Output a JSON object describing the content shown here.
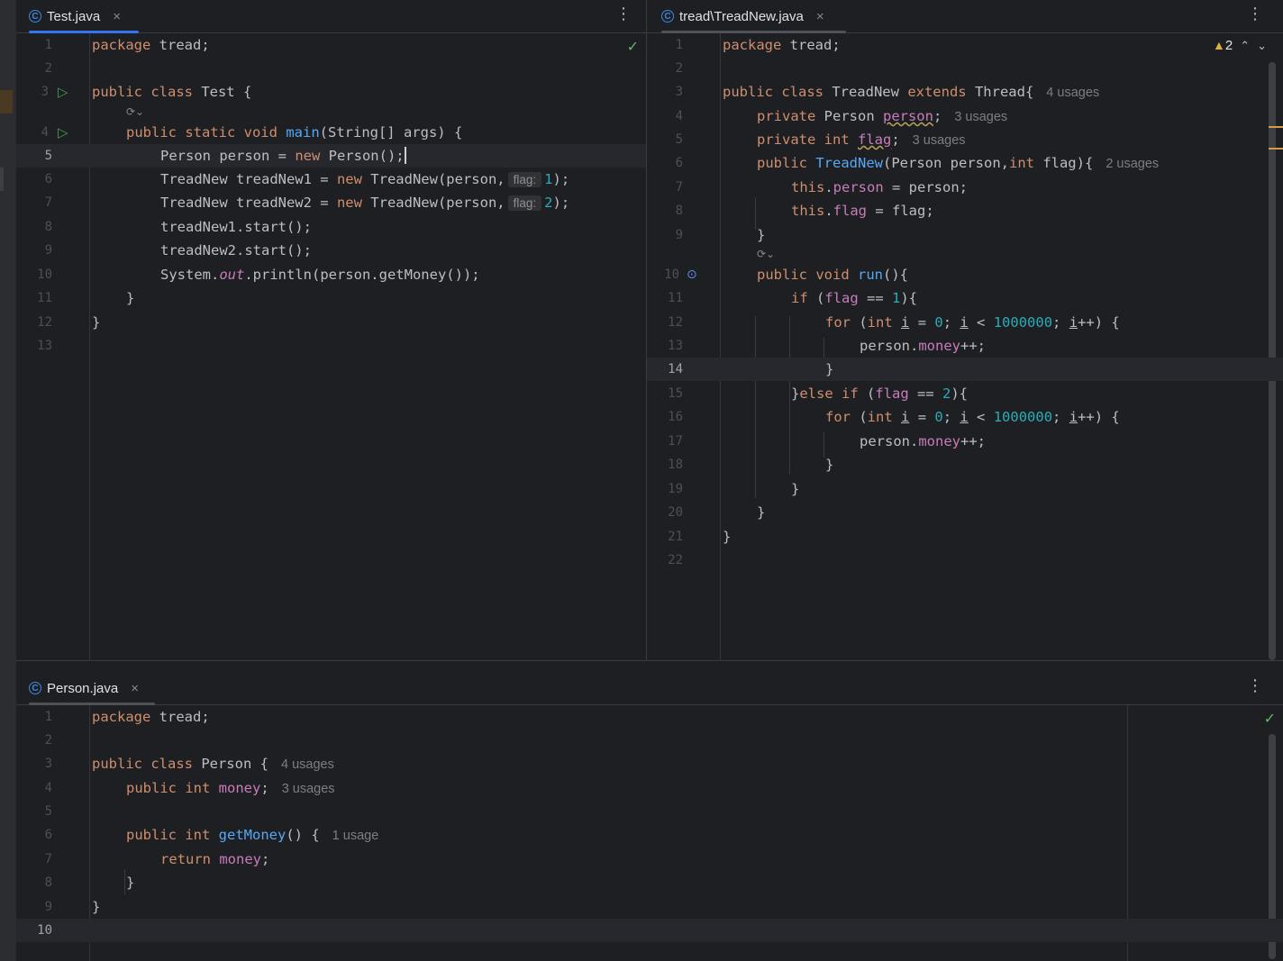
{
  "colors": {
    "background": "#1e1f22",
    "keyword": "#cf8e6d",
    "function": "#56a8f5",
    "field": "#c77dbb",
    "number": "#2aacb8",
    "tab_underline": "#3574f0",
    "ok_check": "#5fb865",
    "warning": "#e0b03d"
  },
  "icons": {
    "class_icon": "C",
    "close_icon": "×",
    "more_icon": "⋮",
    "run_icon": "▷",
    "check_icon": "✓",
    "warning_icon": "▲",
    "override_icon": "⊙",
    "ai_hint_icon": "⟳⌄",
    "chevron_up": "⌃",
    "chevron_down": "⌄"
  },
  "pane_test": {
    "tab_label": "Test.java",
    "lines": [
      {
        "n": "1"
      },
      {
        "n": "2"
      },
      {
        "n": "3"
      },
      {
        "n": "4"
      },
      {
        "n": "5"
      },
      {
        "n": "6"
      },
      {
        "n": "7"
      },
      {
        "n": "8"
      },
      {
        "n": "9"
      },
      {
        "n": "10"
      },
      {
        "n": "11"
      },
      {
        "n": "12"
      },
      {
        "n": "13"
      }
    ],
    "code": {
      "l1_kw": "package",
      "l1_rest": " tread;",
      "l3_kw": "public class",
      "l3_rest": " Test {",
      "l4_kw1": "public static void",
      "l4_fn": "main",
      "l4_rest": "(String[] args) {",
      "l5_a": "Person person = ",
      "l5_kw": "new",
      "l5_b": " Person();",
      "l6_a": "TreadNew treadNew1 = ",
      "l6_kw": "new",
      "l6_b": " TreadNew(person,",
      "l6_hint": "flag:",
      "l6_num": "1",
      "l6_c": ");",
      "l7_a": "TreadNew treadNew2 = ",
      "l7_kw": "new",
      "l7_b": " TreadNew(person,",
      "l7_hint": "flag:",
      "l7_num": "2",
      "l7_c": ");",
      "l8": "treadNew1.start();",
      "l9": "treadNew2.start();",
      "l10_a": "System.",
      "l10_it": "out",
      "l10_b": ".println(person.getMoney());",
      "l11": "}",
      "l12": "}"
    }
  },
  "pane_treadnew": {
    "tab_label": "tread\\TreadNew.java",
    "warning_count": "2",
    "lines": [
      {
        "n": "1"
      },
      {
        "n": "2"
      },
      {
        "n": "3"
      },
      {
        "n": "4"
      },
      {
        "n": "5"
      },
      {
        "n": "6"
      },
      {
        "n": "7"
      },
      {
        "n": "8"
      },
      {
        "n": "9"
      },
      {
        "n": "10"
      },
      {
        "n": "11"
      },
      {
        "n": "12"
      },
      {
        "n": "13"
      },
      {
        "n": "14"
      },
      {
        "n": "15"
      },
      {
        "n": "16"
      },
      {
        "n": "17"
      },
      {
        "n": "18"
      },
      {
        "n": "19"
      },
      {
        "n": "20"
      },
      {
        "n": "21"
      },
      {
        "n": "22"
      }
    ],
    "code": {
      "l1_kw": "package",
      "l1_rest": " tread;",
      "l3_kw": "public class",
      "l3_a": " TreadNew ",
      "l3_kw2": "extends",
      "l3_b": " Thread{",
      "l3_hint": "4 usages",
      "l4_kw": "private",
      "l4_a": " Person ",
      "l4_fld": "person",
      "l4_b": ";",
      "l4_hint": "3 usages",
      "l5_kw": "private int",
      "l5_a": " ",
      "l5_fld": "flag",
      "l5_b": ";",
      "l5_hint": "3 usages",
      "l6_kw": "public",
      "l6_a": " ",
      "l6_fn": "TreadNew",
      "l6_b": "(Person person,",
      "l6_kw2": "int",
      "l6_c": " flag){",
      "l6_hint": "2 usages",
      "l7_kw": "this",
      "l7_a": ".",
      "l7_fld": "person",
      "l7_b": " = person;",
      "l8_kw": "this",
      "l8_a": ".",
      "l8_fld": "flag",
      "l8_b": " = flag;",
      "l9": "}",
      "l10_kw": "public void",
      "l10_a": " ",
      "l10_fn": "run",
      "l10_b": "(){",
      "l11_kw": "if",
      "l11_a": " (",
      "l11_fld": "flag",
      "l11_b": " == ",
      "l11_num": "1",
      "l11_c": "){",
      "l12_kw": "for",
      "l12_a": " (",
      "l12_kw2": "int",
      "l12_b": " ",
      "l12_i1": "i",
      "l12_c": " = ",
      "l12_num1": "0",
      "l12_d": "; ",
      "l12_i2": "i",
      "l12_e": " < ",
      "l12_num2": "1000000",
      "l12_f": "; ",
      "l12_i3": "i",
      "l12_g": "++) {",
      "l13_a": "person.",
      "l13_fld": "money",
      "l13_b": "++;",
      "l14": "}",
      "l15_a": "}",
      "l15_kw": "else if",
      "l15_b": " (",
      "l15_fld": "flag",
      "l15_c": " == ",
      "l15_num": "2",
      "l15_d": "){",
      "l16_kw": "for",
      "l16_a": " (",
      "l16_kw2": "int",
      "l16_b": " ",
      "l16_i1": "i",
      "l16_c": " = ",
      "l16_num1": "0",
      "l16_d": "; ",
      "l16_i2": "i",
      "l16_e": " < ",
      "l16_num2": "1000000",
      "l16_f": "; ",
      "l16_i3": "i",
      "l16_g": "++) {",
      "l17_a": "person.",
      "l17_fld": "money",
      "l17_b": "++;",
      "l18": "}",
      "l19": "}",
      "l20": "}",
      "l21": "}"
    }
  },
  "pane_person": {
    "tab_label": "Person.java",
    "lines": [
      {
        "n": "1"
      },
      {
        "n": "2"
      },
      {
        "n": "3"
      },
      {
        "n": "4"
      },
      {
        "n": "5"
      },
      {
        "n": "6"
      },
      {
        "n": "7"
      },
      {
        "n": "8"
      },
      {
        "n": "9"
      },
      {
        "n": "10"
      }
    ],
    "code": {
      "l1_kw": "package",
      "l1_rest": " tread;",
      "l3_kw": "public class",
      "l3_a": " Person {",
      "l3_hint": "4 usages",
      "l4_kw": "public int",
      "l4_a": " ",
      "l4_fld": "money",
      "l4_b": ";",
      "l4_hint": "3 usages",
      "l6_kw": "public int",
      "l6_a": " ",
      "l6_fn": "getMoney",
      "l6_b": "() {",
      "l6_hint": "1 usage",
      "l7_kw": "return",
      "l7_a": " ",
      "l7_fld": "money",
      "l7_b": ";",
      "l8": "}",
      "l9": "}"
    }
  }
}
